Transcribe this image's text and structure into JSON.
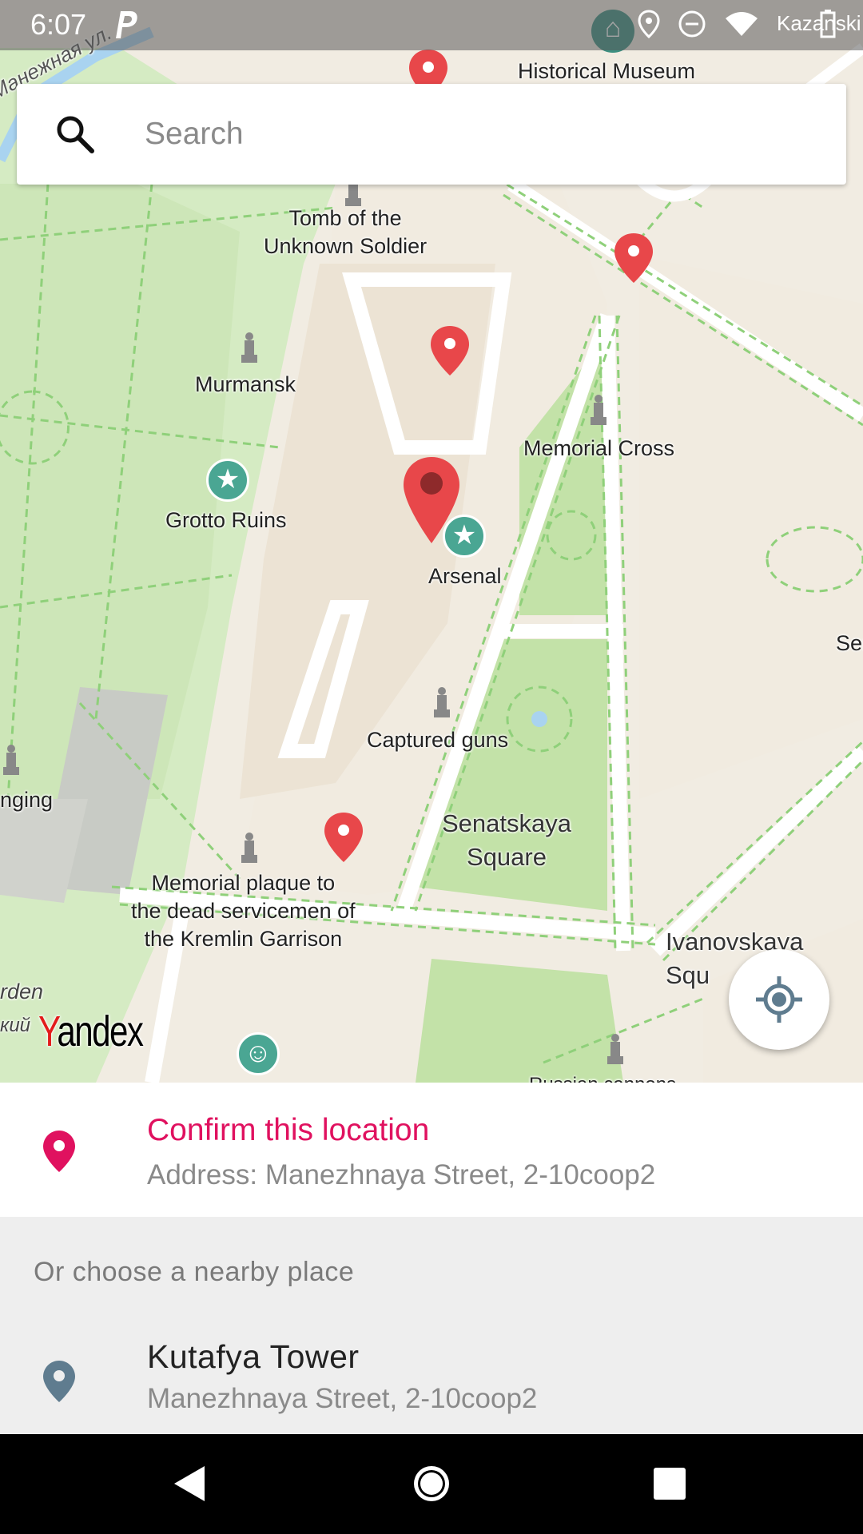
{
  "status_bar": {
    "time": "6:07",
    "icons": [
      "parking-icon",
      "museum-icon",
      "location-icon",
      "dnd-icon",
      "wifi-icon",
      "battery-icon"
    ],
    "edge_text": "Kazanski"
  },
  "search": {
    "placeholder": "Search",
    "value": ""
  },
  "map": {
    "labels": {
      "historical_museum": "Historical Museum",
      "tomb": "Tomb of the\nUnknown Soldier",
      "murmansk": "Murmansk",
      "memorial_cross": "Memorial Cross",
      "grotto_ruins": "Grotto Ruins",
      "arsenal": "Arsenal",
      "captured_guns": "Captured guns",
      "senatskaya": "Senatskaya\nSquare",
      "memorial_plaque": "Memorial plaque to\nthe dead servicemen of\nthe Kremlin Garrison",
      "ivanovskaya": "Ivanovskaya\nSqu",
      "nging": "nging",
      "ser": "Ser",
      "rden": "rden",
      "kiy": "кий",
      "russian_cannons": "Russian cannons",
      "street": "Манежная ул."
    },
    "logo": "Yandex"
  },
  "confirm": {
    "title": "Confirm this location",
    "address": "Address: Manezhnaya Street, 2-10coop2"
  },
  "nearby": {
    "header": "Or choose a nearby place",
    "items": [
      {
        "title": "Kutafya Tower",
        "subtitle": "Manezhnaya Street, 2-10coop2"
      }
    ]
  },
  "colors": {
    "accent_pink": "#e0115f",
    "pin_red": "#e8474a",
    "park_green": "#cde8b6",
    "poi_teal": "#4aa693",
    "nearby_pin": "#5f7c8f"
  }
}
